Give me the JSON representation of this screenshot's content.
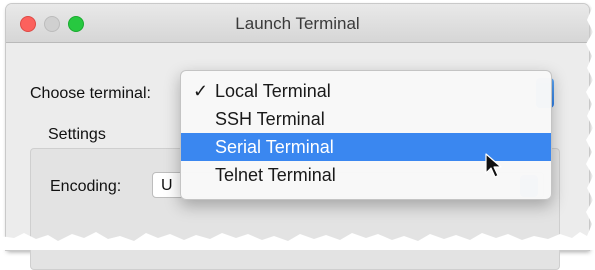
{
  "window": {
    "title": "Launch Terminal"
  },
  "form": {
    "choose_label": "Choose terminal:",
    "settings_label": "Settings",
    "encoding_label": "Encoding:",
    "encoding_value": "U"
  },
  "terminal_menu": {
    "selected": "Local Terminal",
    "highlighted": "Serial Terminal",
    "items": [
      {
        "label": "Local Terminal",
        "checked": true
      },
      {
        "label": "SSH Terminal",
        "checked": false
      },
      {
        "label": "Serial Terminal",
        "checked": false
      },
      {
        "label": "Telnet Terminal",
        "checked": false
      }
    ]
  },
  "icons": {
    "check": "✓",
    "close": "close-icon",
    "minimize": "minimize-icon",
    "zoom": "zoom-icon",
    "cursor": "pointer-cursor-icon"
  },
  "colors": {
    "highlight": "#3a87f0",
    "close_light": "#fc615d",
    "zoom_light": "#27c840",
    "window_bg": "#ececec"
  }
}
